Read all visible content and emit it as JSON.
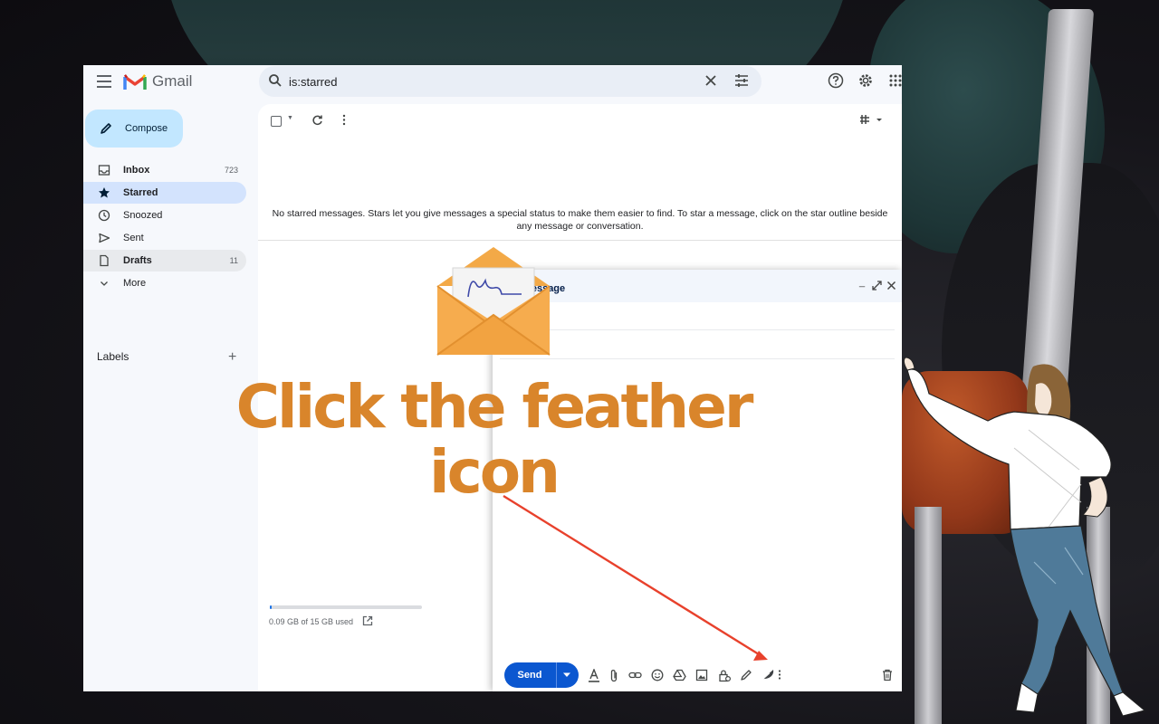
{
  "app": {
    "logo_text": "Gmail"
  },
  "search": {
    "value": "is:starred"
  },
  "sidebar": {
    "compose_label": "Compose",
    "items": [
      {
        "label": "Inbox",
        "count": "723"
      },
      {
        "label": "Starred",
        "count": ""
      },
      {
        "label": "Snoozed",
        "count": ""
      },
      {
        "label": "Sent",
        "count": ""
      },
      {
        "label": "Drafts",
        "count": "11"
      },
      {
        "label": "More",
        "count": ""
      }
    ],
    "labels_heading": "Labels",
    "labels_add": "+"
  },
  "main": {
    "empty_message": "No starred messages. Stars let you give messages a special status to make them easier to find. To star a message, click on the star outline beside any message or conversation."
  },
  "storage": {
    "text": "0.09 GB of 15 GB used",
    "fraction_used": 0.006
  },
  "compose": {
    "title": "New Message",
    "send_label": "Send"
  },
  "overlay": {
    "headline": "Click the feather icon",
    "accent_color": "#d9852b",
    "arrow_color": "#e8412c"
  },
  "colors": {
    "compose_button": "#c2e7ff",
    "active_nav": "#d3e3fd",
    "send_button": "#0b57d0"
  }
}
